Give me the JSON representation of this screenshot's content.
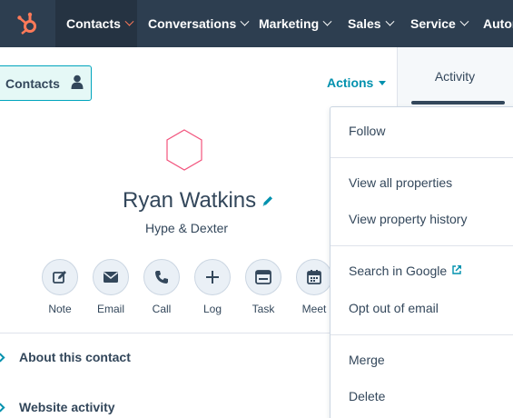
{
  "nav": {
    "items": [
      {
        "label": "Contacts",
        "active": true
      },
      {
        "label": "Conversations",
        "active": false
      },
      {
        "label": "Marketing",
        "active": false
      },
      {
        "label": "Sales",
        "active": false
      },
      {
        "label": "Service",
        "active": false
      },
      {
        "label": "Autom",
        "active": false
      }
    ],
    "brand_color": "#ff7a59",
    "background": "#2d3e50"
  },
  "header": {
    "contacts_button": "Contacts",
    "actions_label": "Actions"
  },
  "right_panel": {
    "activity_tab": "Activity"
  },
  "contact": {
    "name": "Ryan Watkins",
    "company": "Hype & Dexter"
  },
  "quick_actions": [
    {
      "label": "Note",
      "icon": "pencil-note-icon"
    },
    {
      "label": "Email",
      "icon": "envelope-icon"
    },
    {
      "label": "Call",
      "icon": "phone-icon"
    },
    {
      "label": "Log",
      "icon": "plus-icon"
    },
    {
      "label": "Task",
      "icon": "task-icon"
    },
    {
      "label": "Meet",
      "icon": "calendar-icon"
    }
  ],
  "sections": [
    {
      "title": "About this contact"
    },
    {
      "title": "Website activity"
    }
  ],
  "actions_menu": {
    "groups": [
      [
        "Follow"
      ],
      [
        "View all properties",
        "View property history"
      ],
      [
        "Search in Google",
        "Opt out of email"
      ],
      [
        "Merge",
        "Delete"
      ]
    ]
  },
  "colors": {
    "accent": "#0091ae",
    "text": "#33475b",
    "avatar_outline": "#f2547d"
  }
}
